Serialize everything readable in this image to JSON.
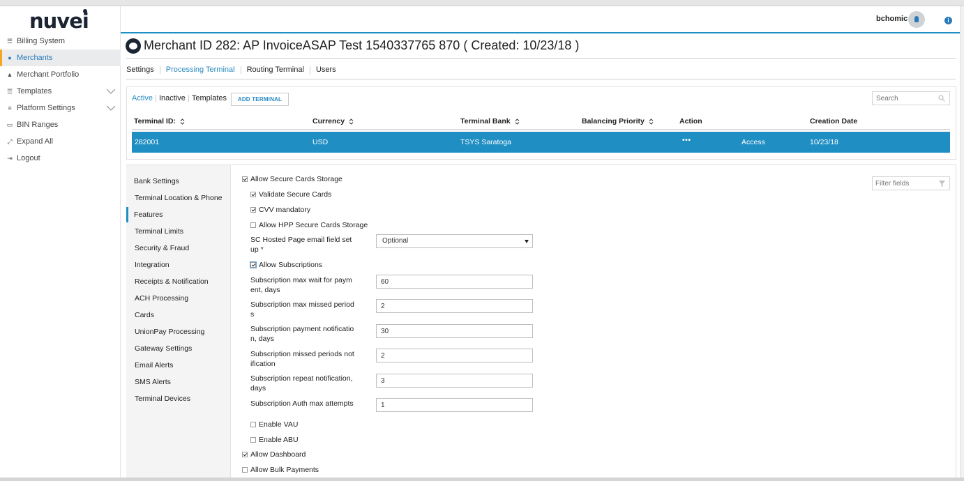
{
  "brand": {
    "logo": "nuvei"
  },
  "sidebar": {
    "items": [
      {
        "label": "Billing System",
        "icon": "list-icon"
      },
      {
        "label": "Merchants",
        "icon": "users-icon",
        "active": true
      },
      {
        "label": "Merchant Portfolio",
        "icon": "user-portfolio-icon"
      },
      {
        "label": "Templates",
        "icon": "list-icon",
        "expandable": true
      },
      {
        "label": "Platform Settings",
        "icon": "sliders-icon",
        "expandable": true
      },
      {
        "label": "BIN Ranges",
        "icon": "card-icon"
      },
      {
        "label": "Expand All",
        "icon": "expand-icon"
      },
      {
        "label": "Logout",
        "icon": "logout-icon"
      }
    ]
  },
  "header": {
    "username": "bchomic",
    "info": "i"
  },
  "page": {
    "title": "Merchant ID 282: AP InvoiceASAP Test 1540337765 870 ( Created: 10/23/18 )"
  },
  "tabs": [
    "Settings",
    "Processing Terminal",
    "Routing Terminal",
    "Users"
  ],
  "active_tab": "Processing Terminal",
  "terminals": {
    "filters": [
      "Active",
      "Inactive",
      "Templates"
    ],
    "active_filter": "Active",
    "add_label": "ADD TERMINAL",
    "search_placeholder": "Search",
    "columns": [
      "Terminal ID:",
      "Currency",
      "Terminal Bank",
      "Balancing Priority",
      "Action",
      "Creation Date"
    ],
    "rows": [
      {
        "terminal_id": "282001",
        "currency": "USD",
        "bank": "TSYS Saratoga",
        "balancing_priority": "",
        "action_menu": "•••",
        "action": "Access",
        "creation_date": "10/23/18"
      }
    ]
  },
  "settings_nav": {
    "items": [
      "Bank Settings",
      "Terminal Location & Phone",
      "Features",
      "Terminal Limits",
      "Security & Fraud",
      "Integration",
      "Receipts & Notification",
      "ACH Processing",
      "Cards",
      "UnionPay Processing",
      "Gateway Settings",
      "Email Alerts",
      "SMS Alerts",
      "Terminal Devices"
    ],
    "active": "Features"
  },
  "features": {
    "filter_placeholder": "Filter fields",
    "allow_secure_cards_storage": {
      "label": "Allow Secure Cards Storage",
      "checked": true
    },
    "validate_secure_cards": {
      "label": "Validate Secure Cards",
      "checked": true
    },
    "cvv_mandatory": {
      "label": "CVV mandatory",
      "checked": true
    },
    "allow_hpp_secure_cards_storage": {
      "label": "Allow HPP Secure Cards Storage",
      "checked": false
    },
    "sc_hosted_email": {
      "label": "SC Hosted Page email field setup *",
      "value": "Optional"
    },
    "allow_subscriptions": {
      "label": "Allow Subscriptions",
      "checked": true
    },
    "sub_max_wait": {
      "label": "Subscription max wait for payment, days",
      "value": "60"
    },
    "sub_max_missed": {
      "label": "Subscription max missed periods",
      "value": "2"
    },
    "sub_payment_notification": {
      "label": "Subscription payment notification, days",
      "value": "30"
    },
    "sub_missed_notification": {
      "label": "Subscription missed periods notification",
      "value": "2"
    },
    "sub_repeat_notification": {
      "label": "Subscription repeat notification, days",
      "value": "3"
    },
    "sub_auth_max_attempts": {
      "label": "Subscription Auth max attempts",
      "value": "1"
    },
    "enable_vau": {
      "label": "Enable VAU",
      "checked": false
    },
    "enable_abu": {
      "label": "Enable ABU",
      "checked": false
    },
    "allow_dashboard": {
      "label": "Allow Dashboard",
      "checked": true
    },
    "allow_bulk_payments": {
      "label": "Allow Bulk Payments",
      "checked": false
    }
  },
  "colors": {
    "accent": "#1f8ec3",
    "brand": "#1b2433",
    "active_marker": "#f5a623"
  }
}
